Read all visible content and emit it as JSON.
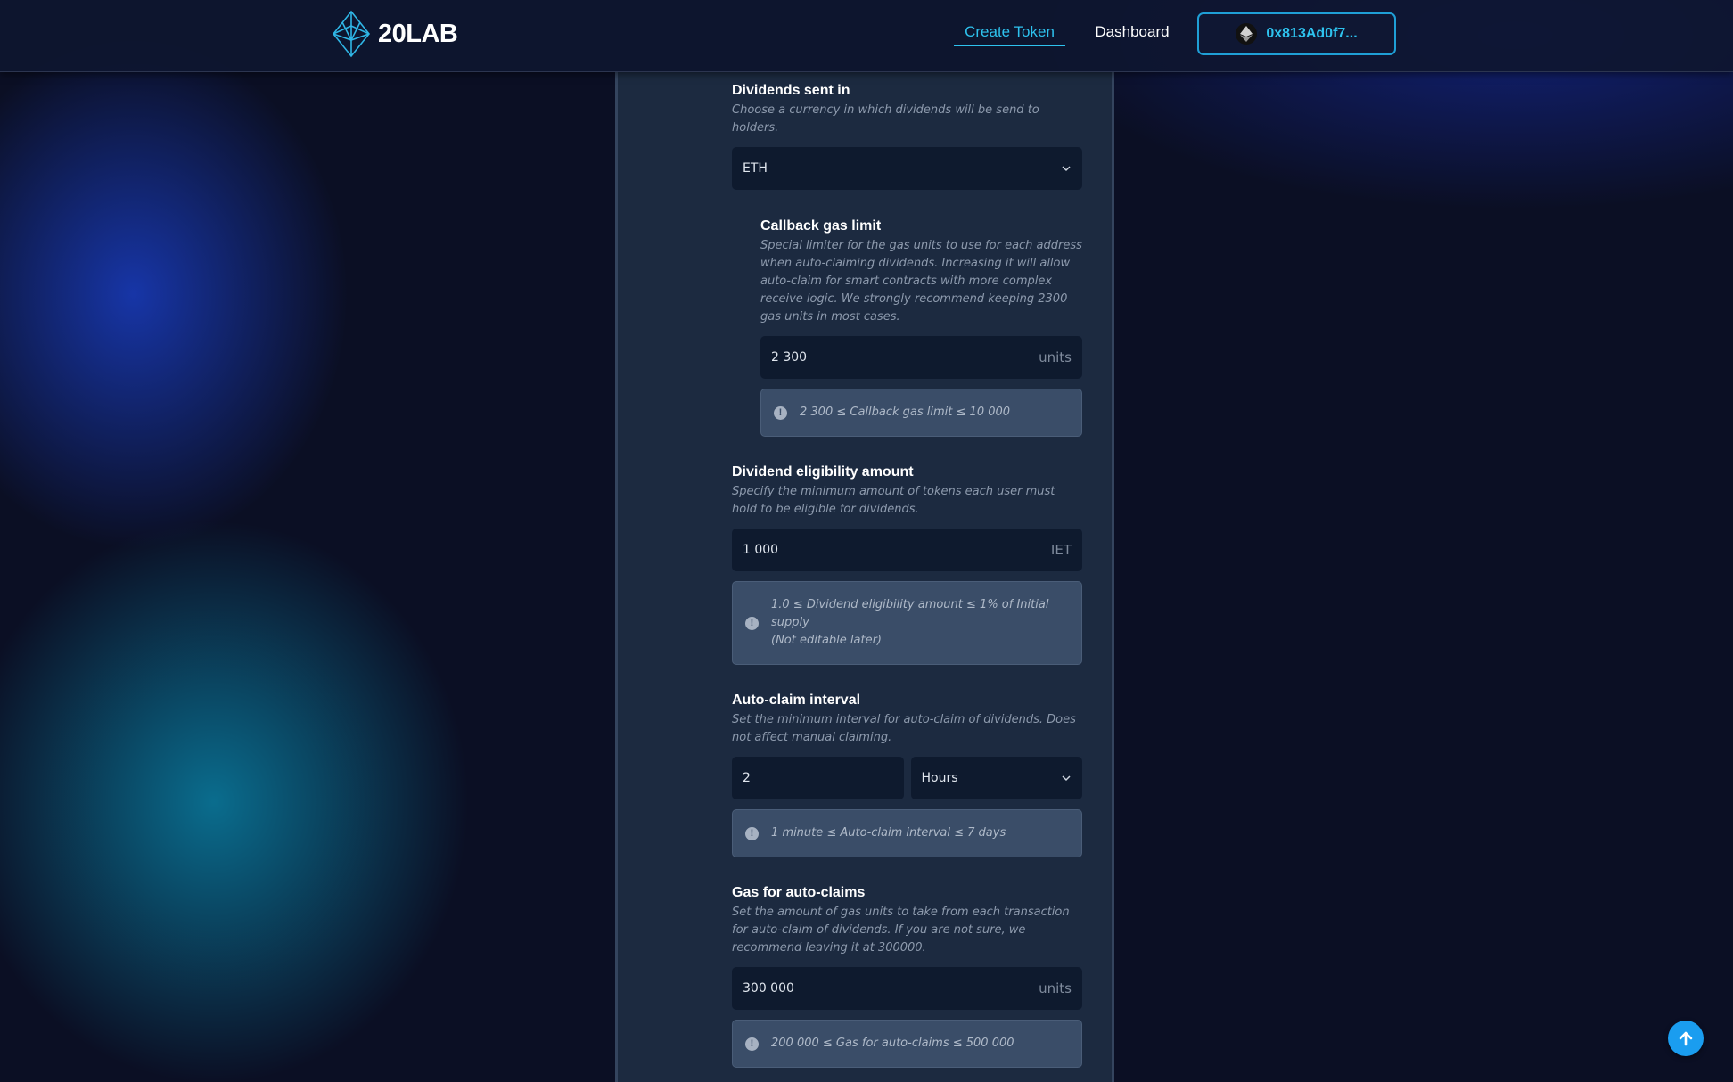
{
  "header": {
    "logo_text": "20LAB",
    "nav": {
      "create_token": "Create Token",
      "dashboard": "Dashboard"
    },
    "wallet_address": "0x813Ad0f7..."
  },
  "dividends_sent_in": {
    "title": "Dividends sent in",
    "description": "Choose a currency in which dividends will be send to holders.",
    "selected": "ETH"
  },
  "callback_gas_limit": {
    "title": "Callback gas limit",
    "description": "Special limiter for the gas units to use for each address when auto-claiming dividends. Increasing it will allow auto-claim for smart contracts with more complex receive logic. We strongly recommend keeping 2300 gas units in most cases.",
    "value": "2 300",
    "suffix": "units",
    "note": "2 300 ≤ Callback gas limit ≤ 10 000"
  },
  "dividend_eligibility": {
    "title": "Dividend eligibility amount",
    "description": "Specify the minimum amount of tokens each user must hold to be eligible for dividends.",
    "value": "1 000",
    "suffix": "IET",
    "note_line1": "1.0 ≤ Dividend eligibility amount ≤ 1% of Initial supply",
    "note_line2": "(Not editable later)"
  },
  "auto_claim_interval": {
    "title": "Auto-claim interval",
    "description": "Set the minimum interval for auto-claim of dividends. Does not affect manual claiming.",
    "value": "2",
    "unit": "Hours",
    "note": "1 minute ≤ Auto-claim interval ≤ 7 days"
  },
  "gas_auto_claims": {
    "title": "Gas for auto-claims",
    "description": "Set the amount of gas units to take from each transaction for auto-claim of dividends. If you are not sure, we recommend leaving it at 300000.",
    "value": "300 000",
    "suffix": "units",
    "note": "200 000 ≤ Gas for auto-claims ≤ 500 000"
  },
  "icons": {
    "logo": "diamond-logo-icon",
    "wallet": "ethereum-icon",
    "select": "chevron-down-icon",
    "note": "exclamation-circle-icon",
    "scroll_top": "arrow-up-icon"
  },
  "colors": {
    "accent": "#2ec2ee",
    "panel": "#1c2a40",
    "field": "#0e1a2e",
    "note_bg": "#3a4d68",
    "fab": "#1a9df0"
  }
}
